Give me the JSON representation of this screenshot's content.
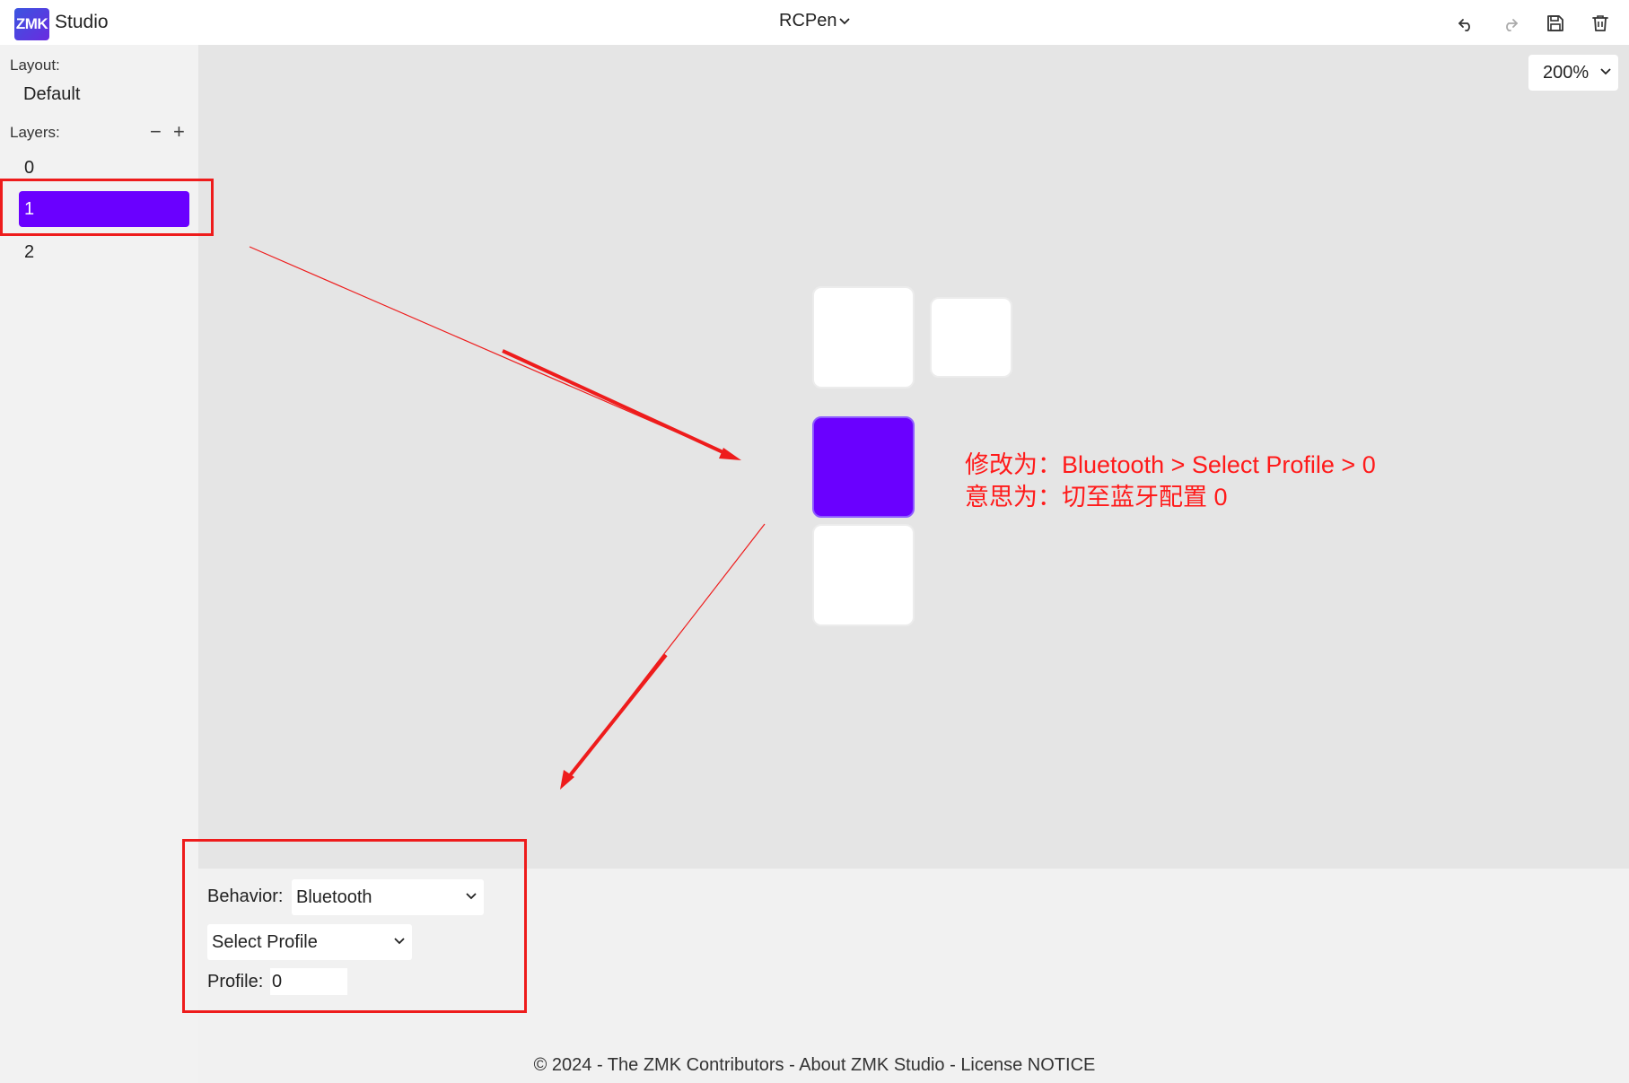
{
  "header": {
    "logo_text": "ZMK",
    "app_name": "Studio",
    "device_name": "RCPen",
    "icons": [
      "undo-icon",
      "redo-icon",
      "save-icon",
      "trash-icon"
    ]
  },
  "sidebar": {
    "layout_label": "Layout:",
    "layout_value": "Default",
    "layers_label": "Layers:",
    "remove_layer_symbol": "−",
    "add_layer_symbol": "+",
    "layers": [
      {
        "label": "0",
        "selected": false
      },
      {
        "label": "1",
        "selected": true
      },
      {
        "label": "2",
        "selected": false
      }
    ]
  },
  "canvas": {
    "zoom": "200%",
    "keys": [
      {
        "id": "key-top-left",
        "selected": false
      },
      {
        "id": "key-top-right",
        "selected": false
      },
      {
        "id": "key-middle",
        "selected": true
      },
      {
        "id": "key-bottom",
        "selected": false
      }
    ],
    "annotation": {
      "line1": "修改为：Bluetooth > Select Profile > 0",
      "line2": "意思为：切至蓝牙配置 0",
      "color": "#ff1a1a"
    }
  },
  "behavior_panel": {
    "behavior_label": "Behavior:",
    "behavior_value": "Bluetooth",
    "action_value": "Select Profile",
    "profile_label": "Profile:",
    "profile_value": "0"
  },
  "footer": {
    "copyright": "© 2024 - The ZMK Contributors",
    "separator": " - ",
    "about_link": "About ZMK Studio",
    "license_link": "License NOTICE"
  },
  "colors": {
    "accent": "#6a00ff",
    "annotation_red": "#ee1c1c"
  }
}
